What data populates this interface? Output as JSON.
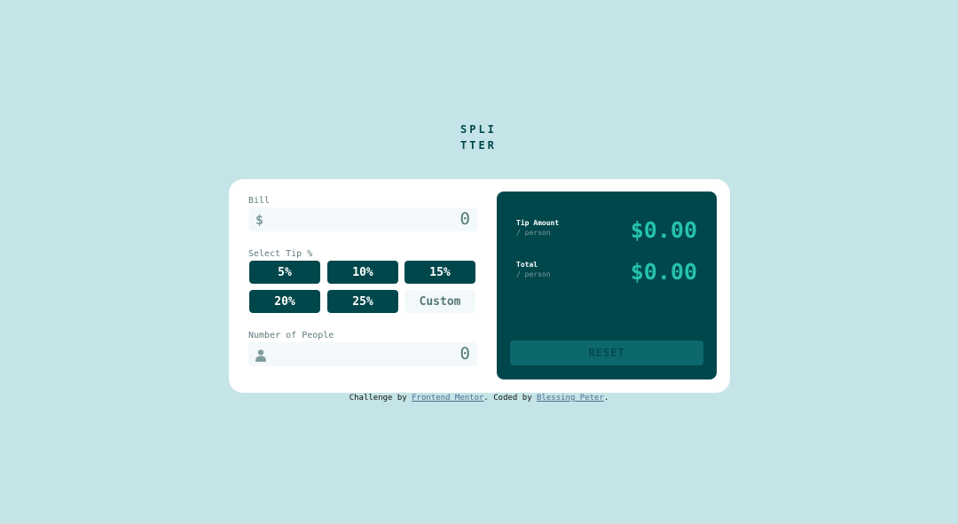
{
  "logo": {
    "text": "SPLITTER"
  },
  "bill": {
    "label": "Bill",
    "icon": "$",
    "value": "0"
  },
  "tip": {
    "label": "Select Tip %",
    "options": [
      "5%",
      "10%",
      "15%",
      "20%",
      "25%"
    ],
    "custom_placeholder": "Custom"
  },
  "people": {
    "label": "Number of People",
    "value": "0"
  },
  "results": {
    "tip_amount_label": "Tip Amount",
    "tip_amount_sub": "/ person",
    "tip_amount_value": "$0.00",
    "total_label": "Total",
    "total_sub": "/ person",
    "total_value": "$0.00",
    "reset_label": "RESET"
  },
  "footer": {
    "prefix": "Challenge by ",
    "link1": "Frontend Mentor",
    "middle": ". Coded by ",
    "link2": "Blessing Peter",
    "suffix": "."
  },
  "colors": {
    "background": "#c5e4e7",
    "primary": "#00474b",
    "accent": "#26c2ae",
    "input_bg": "#f3f9fa"
  }
}
